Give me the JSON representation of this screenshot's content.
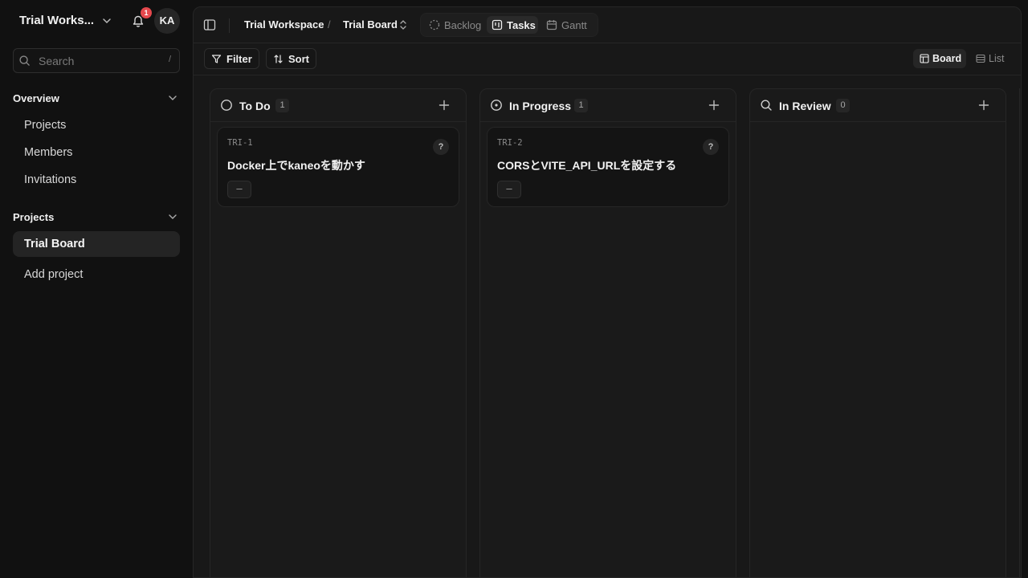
{
  "sidebar": {
    "workspace_name": "Trial Works...",
    "notifications_count": "1",
    "avatar_initials": "KA",
    "search": {
      "placeholder": "Search",
      "shortcut": "/"
    },
    "overview": {
      "label": "Overview",
      "items": [
        {
          "label": "Projects"
        },
        {
          "label": "Members"
        },
        {
          "label": "Invitations"
        }
      ]
    },
    "projects": {
      "label": "Projects",
      "items": [
        {
          "label": "Trial Board",
          "active": true
        }
      ],
      "add_label": "Add project"
    }
  },
  "header": {
    "breadcrumb": {
      "workspace": "Trial Workspace",
      "separator": "/",
      "project": "Trial Board"
    },
    "view_tabs": [
      {
        "label": "Backlog",
        "icon": "dashed-circle-icon",
        "active": false
      },
      {
        "label": "Tasks",
        "icon": "kanban-icon",
        "active": true
      },
      {
        "label": "Gantt",
        "icon": "calendar-icon",
        "active": false
      }
    ]
  },
  "toolbar": {
    "filter_label": "Filter",
    "sort_label": "Sort",
    "views": [
      {
        "label": "Board",
        "icon": "board-icon",
        "active": true
      },
      {
        "label": "List",
        "icon": "list-icon",
        "active": false
      }
    ]
  },
  "board": {
    "columns": [
      {
        "title": "To Do",
        "count": "1",
        "icon": "circle-icon",
        "cards": [
          {
            "id": "TRI-1",
            "title": "Docker上でkaneoを動かす",
            "help": "?",
            "priority": "–"
          }
        ]
      },
      {
        "title": "In Progress",
        "count": "1",
        "icon": "circle-dot-icon",
        "cards": [
          {
            "id": "TRI-2",
            "title": "CORSとVITE_API_URLを設定する",
            "help": "?",
            "priority": "–"
          }
        ]
      },
      {
        "title": "In Review",
        "count": "0",
        "icon": "search-icon",
        "cards": []
      }
    ]
  },
  "colors": {
    "background": "#111111",
    "panel": "#181818",
    "notification_badge": "#e5484d",
    "text_primary": "#f2f2f2",
    "text_muted": "#8a8a8a"
  }
}
